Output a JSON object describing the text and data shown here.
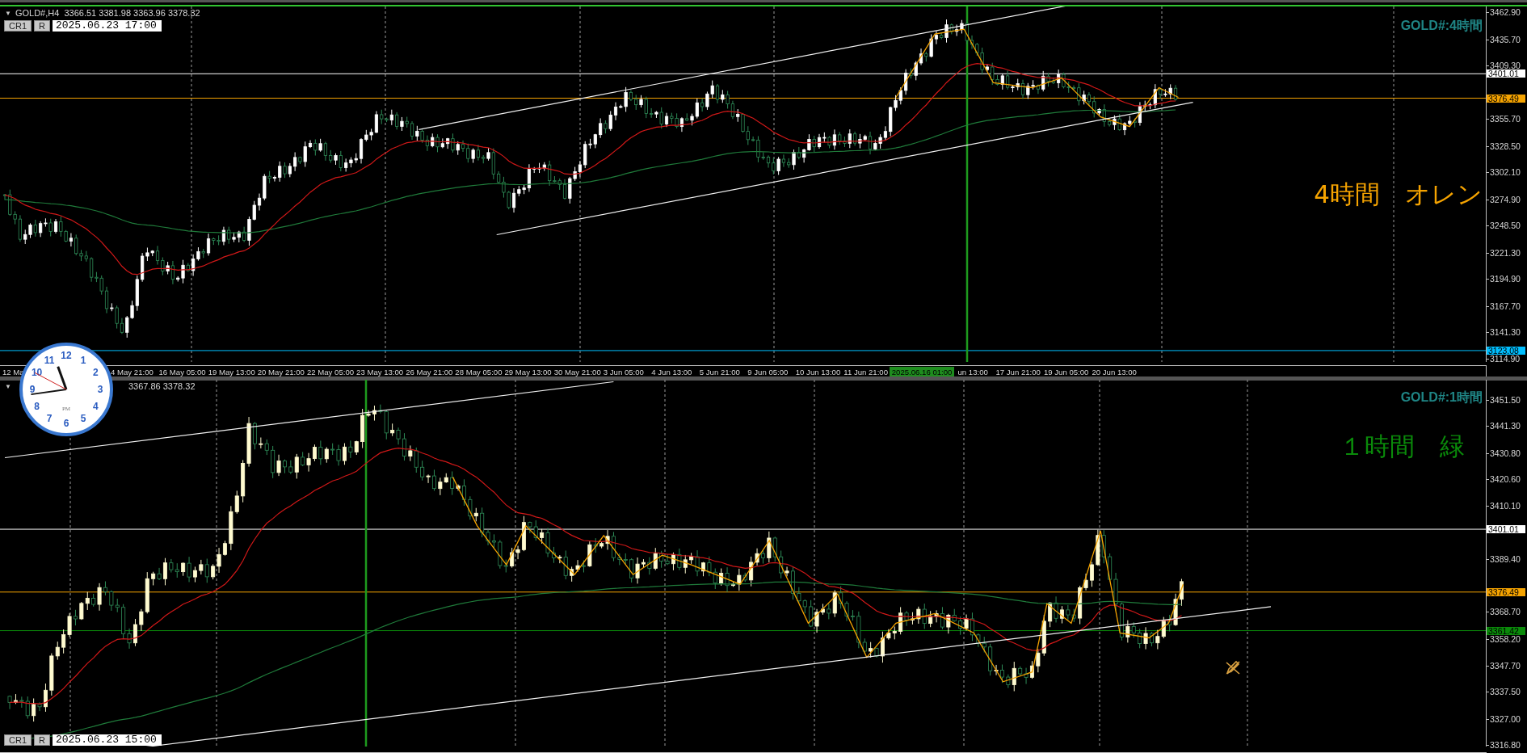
{
  "panels": [
    {
      "active": true,
      "header": {
        "caret": "▼",
        "quote": "GOLD#,H4  3366.51 3381.98 3363.96 3378.32"
      },
      "controls": {
        "buttons": [
          "CR1",
          "R"
        ],
        "date": "2025.06.23 17:00"
      },
      "symbol_label": "GOLD#:4時間",
      "note": {
        "text": "4時間　オレン",
        "color": "#f5a300"
      },
      "price_ticks": [
        "3462.90",
        "3435.70",
        "3409.30",
        "3355.70",
        "3328.50",
        "3302.10",
        "3274.90",
        "3248.50",
        "3221.30",
        "3194.90",
        "3167.70",
        "3141.30",
        "3114.90"
      ],
      "price_markers": [
        {
          "price": "3401.01",
          "color": "#ffffff"
        },
        {
          "price": "3376.49",
          "color": "#f5a300"
        },
        {
          "price": "3123.08",
          "color": "#00bfff"
        }
      ],
      "time_labels": [
        {
          "text": "12 Ma",
          "kind": "label"
        },
        {
          "text": "4 May 21:00",
          "kind": "label"
        },
        {
          "text": "16 May 05:00",
          "kind": "label"
        },
        {
          "text": "19 May 13:00",
          "kind": "label"
        },
        {
          "text": "20 May 21:00",
          "kind": "label"
        },
        {
          "text": "22 May 05:00",
          "kind": "label"
        },
        {
          "text": "23 May 13:00",
          "kind": "label"
        },
        {
          "text": "26 May 21:00",
          "kind": "label"
        },
        {
          "text": "28 May 05:00",
          "kind": "label"
        },
        {
          "text": "29 May 13:00",
          "kind": "label"
        },
        {
          "text": "30 May 21:00",
          "kind": "label"
        },
        {
          "text": "3 Jun 05:00",
          "kind": "label"
        },
        {
          "text": "4 Jun 13:00",
          "kind": "label"
        },
        {
          "text": "5 Jun 21:00",
          "kind": "label"
        },
        {
          "text": "9 Jun 05:00",
          "kind": "label"
        },
        {
          "text": "10 Jun 13:00",
          "kind": "label"
        },
        {
          "text": "11 Jun 21:00",
          "kind": "label"
        },
        {
          "text": "2025.06.16 01:00",
          "kind": "cursor"
        },
        {
          "text": "un 13:00",
          "kind": "label"
        },
        {
          "text": "17 Jun 21:00",
          "kind": "label"
        },
        {
          "text": "19 Jun 05:00",
          "kind": "label"
        },
        {
          "text": "20 Jun 13:00",
          "kind": "label"
        }
      ]
    },
    {
      "active": false,
      "header": {
        "caret": "▼",
        "quote": "3367.86 3378.32"
      },
      "controls": {
        "buttons": [
          "CR1",
          "R"
        ],
        "date": "2025.06.23 15:00"
      },
      "symbol_label": "GOLD#:1時間",
      "note": {
        "text": "１時間　緑",
        "color": "#0a8a0a"
      },
      "price_ticks": [
        "3451.50",
        "3441.30",
        "3430.80",
        "3420.60",
        "3410.10",
        "3389.40",
        "3368.70",
        "3358.20",
        "3347.70",
        "3337.50",
        "3327.00",
        "3316.80"
      ],
      "price_markers": [
        {
          "price": "3401.01",
          "color": "#ffffff"
        },
        {
          "price": "3376.49",
          "color": "#f5a300"
        },
        {
          "price": "3361.42",
          "color": "#0a8a0a"
        }
      ]
    }
  ],
  "clock": {
    "numerals": [
      "12",
      "11",
      "1",
      "10",
      "2",
      "9",
      "3",
      "8",
      "4",
      "7",
      "5",
      "6"
    ],
    "period": "PM"
  }
}
